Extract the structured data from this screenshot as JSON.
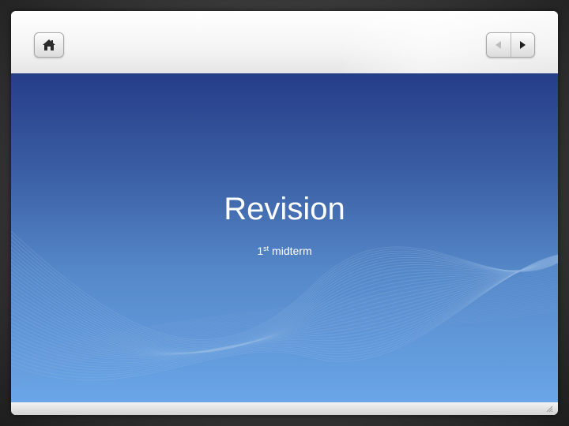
{
  "toolbar": {
    "home": {
      "icon": "home-icon"
    },
    "prev": {
      "icon": "arrow-left-icon"
    },
    "next": {
      "icon": "arrow-right-icon"
    }
  },
  "slide": {
    "title": "Revision",
    "subtitle_number": "1",
    "subtitle_suffix": "st",
    "subtitle_text": " midterm"
  },
  "colors": {
    "slide_top": "#263d8a",
    "slide_bottom": "#6aa6e8",
    "text": "#ffffff"
  }
}
